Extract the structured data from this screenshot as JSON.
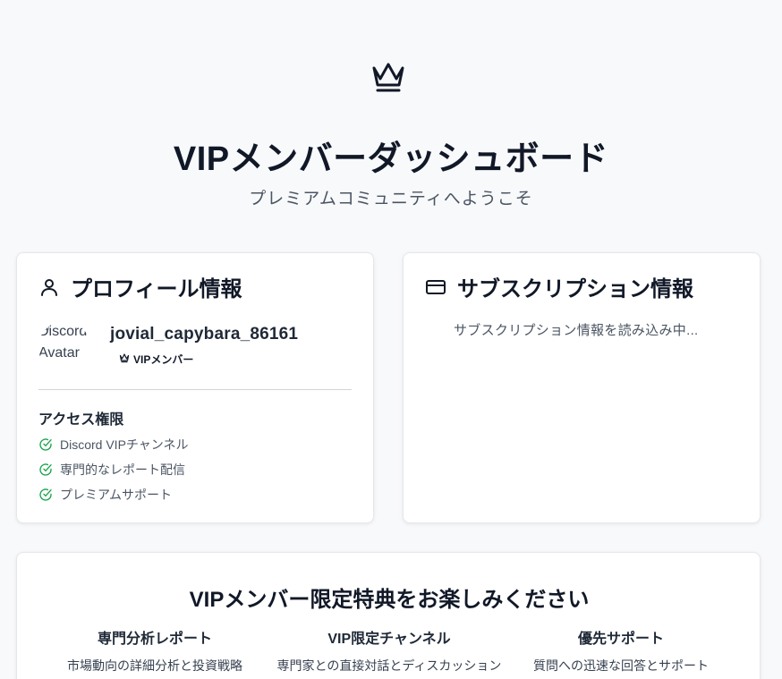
{
  "hero": {
    "icon": "crown-icon",
    "title": "VIPメンバーダッシュボード",
    "subtitle": "プレミアムコミュニティへようこそ"
  },
  "profile": {
    "header_icon": "user-icon",
    "title": "プロフィール情報",
    "avatar_alt": "Discord Avatar",
    "username": "jovial_capybara_86161",
    "badge": "VIPメンバー",
    "access_title": "アクセス権限",
    "access_items": [
      "Discord VIPチャンネル",
      "専門的なレポート配信",
      "プレミアムサポート"
    ]
  },
  "subscription": {
    "header_icon": "credit-card-icon",
    "title": "サブスクリプション情報",
    "loading_text": "サブスクリプション情報を読み込み中..."
  },
  "benefits": {
    "title": "VIPメンバー限定特典をお楽しみください",
    "items": [
      {
        "title": "専門分析レポート",
        "desc": "市場動向の詳細分析と投資戦略"
      },
      {
        "title": "VIP限定チャンネル",
        "desc": "専門家との直接対話とディスカッション"
      },
      {
        "title": "優先サポート",
        "desc": "質問への迅速な回答とサポート"
      }
    ]
  },
  "colors": {
    "background": "#f8f9fb",
    "card": "#ffffff",
    "check_green": "#16a34a",
    "text_primary": "#111827"
  }
}
